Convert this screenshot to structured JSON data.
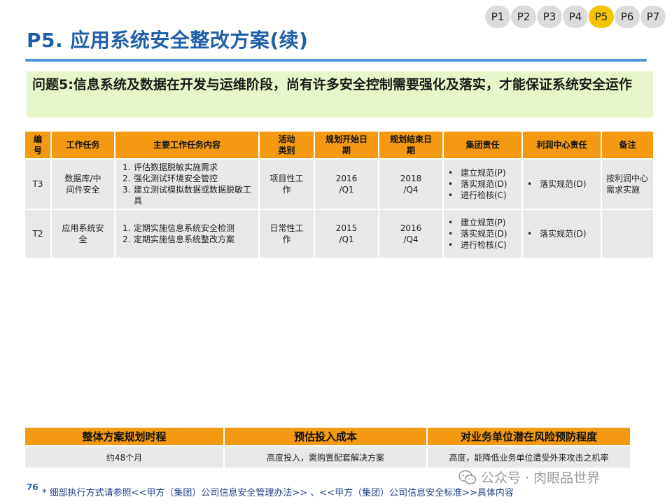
{
  "pager": [
    {
      "label": "P1",
      "active": false
    },
    {
      "label": "P2",
      "active": false
    },
    {
      "label": "P3",
      "active": false
    },
    {
      "label": "P4",
      "active": false
    },
    {
      "label": "P5",
      "active": true
    },
    {
      "label": "P6",
      "active": false
    },
    {
      "label": "P7",
      "active": false
    }
  ],
  "title": "P5. 应用系统安全整改方案(续)",
  "problem": "问题5:信息系统及数据在开发与运维阶段，尚有许多安全控制需要强化及落实，才能保证系统安全运作",
  "table": {
    "headers": [
      "编\n号",
      "工作任务",
      "主要工作任务内容",
      "活动\n类别",
      "规划开始日\n期",
      "规划结束日\n期",
      "集团责任",
      "利润中心责任",
      "备注"
    ],
    "rows": [
      {
        "id": "T3",
        "task": "数据库/中\n间件安全",
        "content": [
          "评估数据脱敏实施需求",
          "强化测试环境安全管控",
          "建立测试模拟数据或数据脱敏工具"
        ],
        "category": "项目性工\n作",
        "start": "2016\n/Q1",
        "end": "2018\n/Q4",
        "group": [
          "建立规范(P)",
          "落实规范(D)",
          "进行检核(C)"
        ],
        "profit": [
          "落实规范(D)"
        ],
        "remark": "按利润中心\n需求实施"
      },
      {
        "id": "T2",
        "task": "应用系统安\n全",
        "content": [
          "定期实施信息系统安全检测",
          "定期实施信息系统整改方案"
        ],
        "category": "日常性工\n作",
        "start": "2015\n/Q1",
        "end": "2016\n/Q4",
        "group": [
          "建立规范(P)",
          "落实规范(D)",
          "进行检核(C)"
        ],
        "profit": [
          "落实规范(D)"
        ],
        "remark": ""
      }
    ]
  },
  "summary": {
    "headers": [
      "整体方案规划时程",
      "预估投入成本",
      "对业务单位潜在风险预防程度"
    ],
    "values": [
      "约48个月",
      "高度投入，需购置配套解决方案",
      "高度，能降低业务单位遭受外来攻击之机率"
    ]
  },
  "page_number": "76",
  "footnote": "* 细部执行方式请参照<<甲方（集团）公司信息安全管理办法>> 、<<甲方（集团）公司信息安全标准>>具体内容",
  "watermark": "公众号 · 肉眼品世界",
  "colors": {
    "accent_orange": "#f39a12",
    "title_blue": "#1f5fa8",
    "problem_green": "#e6f6c8",
    "active_pill": "#f5c400"
  }
}
